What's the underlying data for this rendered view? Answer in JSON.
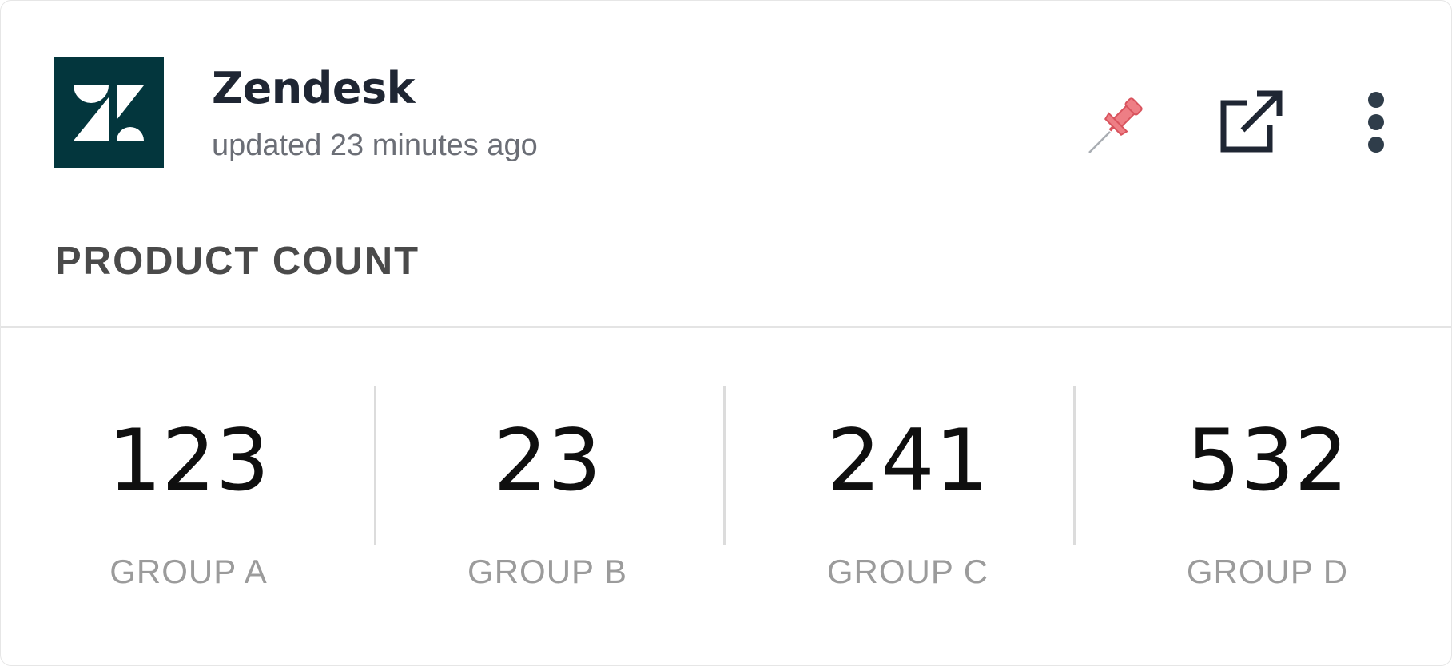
{
  "header": {
    "app_name": "Zendesk",
    "updated_text": "updated 23 minutes ago",
    "logo_icon": "zendesk-logo",
    "logo_bg": "#03363d",
    "actions": [
      {
        "icon": "pin-icon",
        "color": "#e8707a"
      },
      {
        "icon": "external-link-icon",
        "color": "#1f2633"
      },
      {
        "icon": "more-vertical-icon",
        "color": "#2f3d4a"
      }
    ]
  },
  "section": {
    "title": "PRODUCT COUNT"
  },
  "stats": [
    {
      "value": "123",
      "label": "GROUP A"
    },
    {
      "value": "23",
      "label": "GROUP B"
    },
    {
      "value": "241",
      "label": "GROUP C"
    },
    {
      "value": "532",
      "label": "GROUP D"
    }
  ]
}
